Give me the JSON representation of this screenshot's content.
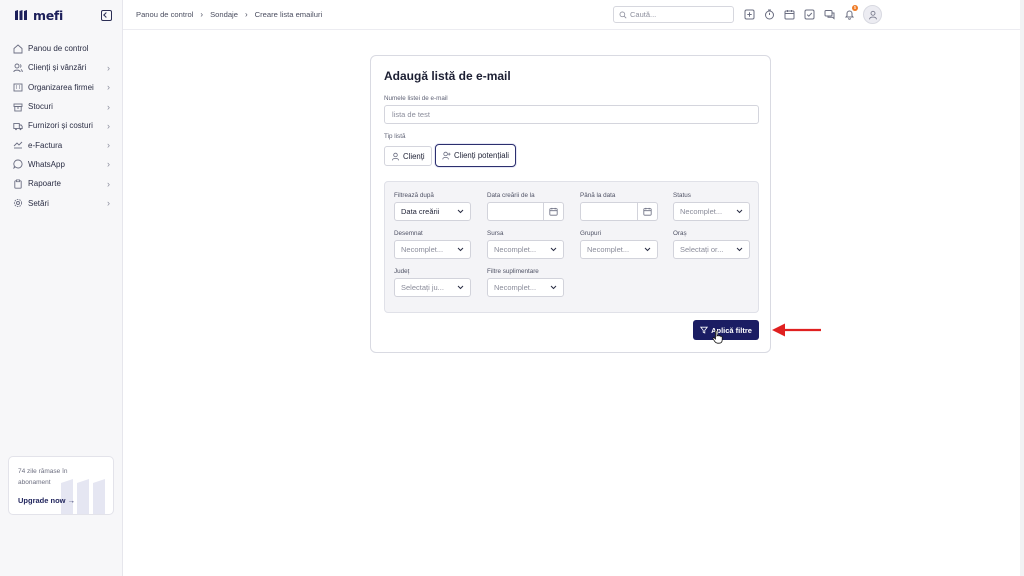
{
  "brand": {
    "name": "mefi",
    "color": "#1c1f5a"
  },
  "sidebar": {
    "items": [
      {
        "label": "Panou de control",
        "icon": "home-icon",
        "has_chevron": false
      },
      {
        "label": "Clienți și vânzări",
        "icon": "users-icon",
        "has_chevron": true
      },
      {
        "label": "Organizarea firmei",
        "icon": "building-icon",
        "has_chevron": true
      },
      {
        "label": "Stocuri",
        "icon": "box-icon",
        "has_chevron": true
      },
      {
        "label": "Furnizori și costuri",
        "icon": "truck-icon",
        "has_chevron": true
      },
      {
        "label": "e-Factura",
        "icon": "efactura-icon",
        "has_chevron": true
      },
      {
        "label": "WhatsApp",
        "icon": "chat-icon",
        "has_chevron": true
      },
      {
        "label": "Rapoarte",
        "icon": "clipboard-icon",
        "has_chevron": true
      },
      {
        "label": "Setări",
        "icon": "gear-icon",
        "has_chevron": true
      }
    ],
    "upgrade": {
      "days_text": "74 zile rămase în abonament",
      "link_label": "Upgrade now"
    }
  },
  "header": {
    "breadcrumb": [
      "Panou de control",
      "Sondaje",
      "Creare lista emailuri"
    ],
    "search_placeholder": "Caută...",
    "notification_count": "5"
  },
  "form": {
    "title": "Adaugă listă de e-mail",
    "name_label": "Numele listei de e-mail",
    "name_value": "lista de test",
    "type_label": "Tip listă",
    "type_options": [
      "Clienți",
      "Clienți potențiali"
    ],
    "type_selected": "Clienți potențiali",
    "filters": {
      "filter_by_label": "Filtrează după",
      "filter_by_value": "Data creării",
      "created_from_label": "Data creării de la",
      "until_label": "Până la data",
      "status_label": "Status",
      "status_value": "Necomplet...",
      "assigned_label": "Desemnat",
      "assigned_value": "Necomplet...",
      "source_label": "Sursa",
      "source_value": "Necomplet...",
      "groups_label": "Grupuri",
      "groups_value": "Necomplet...",
      "city_label": "Oraș",
      "city_value": "Selectați or...",
      "county_label": "Județ",
      "county_value": "Selectați ju...",
      "extra_label": "Filtre suplimentare",
      "extra_value": "Necomplet..."
    },
    "apply_label": "Aplică filtre",
    "accent_color": "#1b1d63",
    "annotation_arrow_color": "#e02020"
  }
}
